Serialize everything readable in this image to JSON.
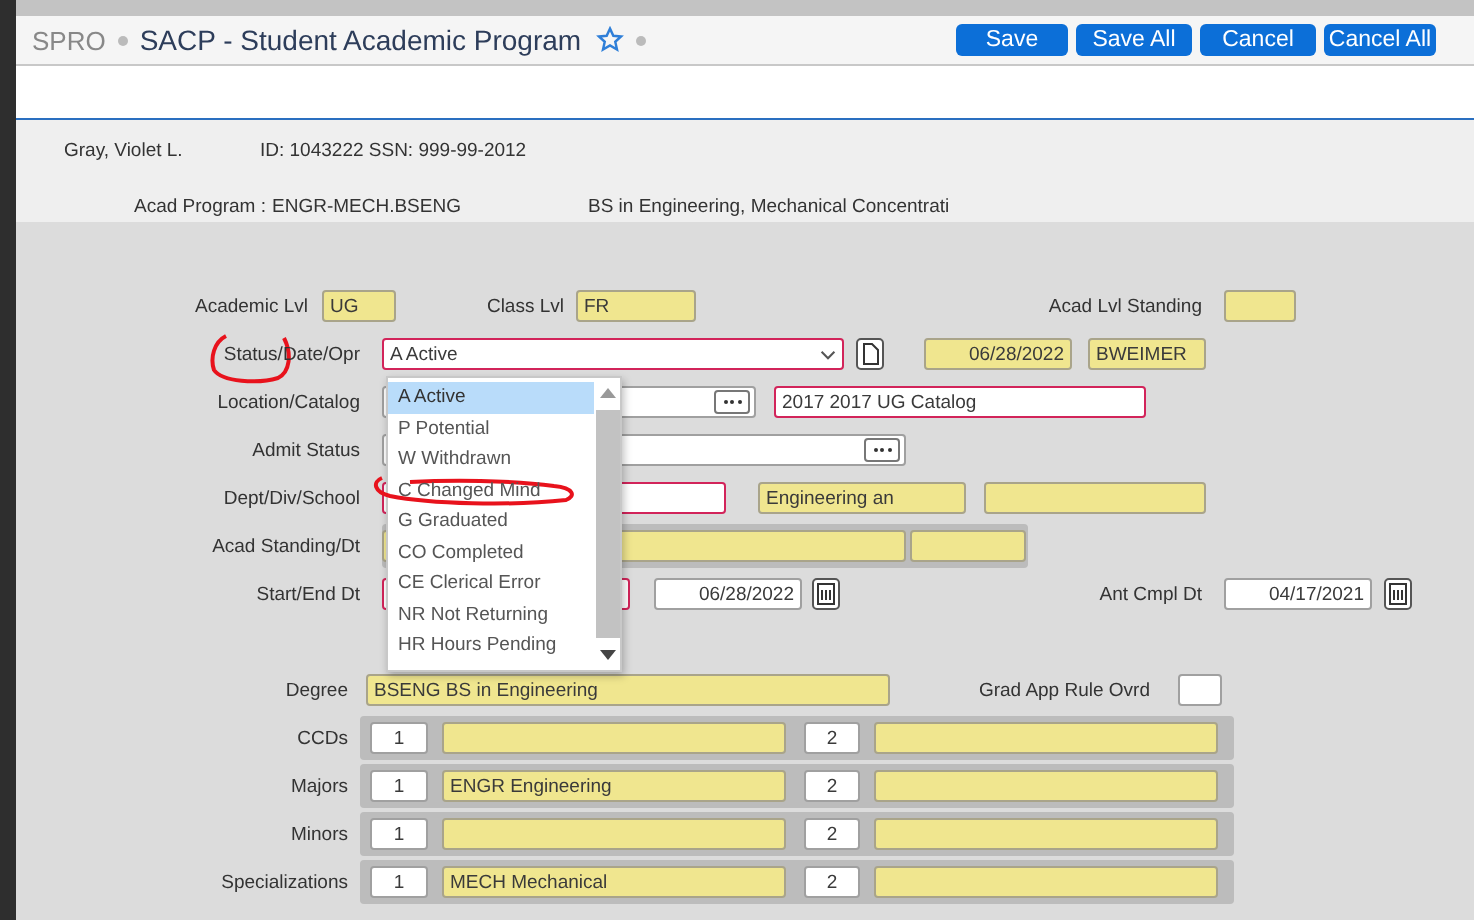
{
  "header": {
    "breadcrumb": "SPRO",
    "title": "SACP - Student Academic Program",
    "buttons": [
      "Save",
      "Save All",
      "Cancel",
      "Cancel All"
    ]
  },
  "student": {
    "name": "Gray,  Violet L.",
    "id_line": "ID: 1043222 SSN: 999-99-2012",
    "program_label": "Acad Program :",
    "program_code": "ENGR-MECH.BSENG",
    "program_desc": "BS in Engineering, Mechanical Concentrati"
  },
  "form": {
    "academic_lvl": {
      "label": "Academic Lvl",
      "value": "UG"
    },
    "class_lvl": {
      "label": "Class Lvl",
      "value": "FR"
    },
    "acad_lvl_standing": {
      "label": "Acad Lvl Standing"
    },
    "status": {
      "label": "Status/Date/Opr",
      "value": "A Active",
      "required": true,
      "date": "06/28/2022",
      "operator": "BWEIMER"
    },
    "location": {
      "label": "Location/Catalog",
      "required": false,
      "catalog": "2017 2017 UG Catalog",
      "catalog_required": true
    },
    "admit_status": {
      "label": "Admit Status",
      "required": false
    },
    "dept": {
      "label": "Dept/Div/School",
      "required": true,
      "division": "Engineering an"
    },
    "acad_standing": {
      "label": "Acad Standing/Dt"
    },
    "start_end": {
      "label": "Start/End Dt",
      "required": true,
      "end_date": "06/28/2022"
    },
    "ant_cmpl": {
      "label": "Ant Cmpl Dt",
      "value": "04/17/2021"
    },
    "degree": {
      "label": "Degree",
      "value": "BSENG BS in Engineering"
    },
    "grad_app": {
      "label": "Grad App Rule Ovrd"
    }
  },
  "multi": [
    {
      "label": "CCDs",
      "slot1": "1",
      "slot2": "2"
    },
    {
      "label": "Majors",
      "slot1": "1",
      "value1": "ENGR Engineering",
      "slot2": "2"
    },
    {
      "label": "Minors",
      "slot1": "1",
      "slot2": "2"
    },
    {
      "label": "Specializations",
      "slot1": "1",
      "value1": "MECH Mechanical",
      "slot2": "2"
    }
  ],
  "dropdown": [
    {
      "label": "A Active",
      "selected": true
    },
    {
      "label": "P Potential",
      "selected": false
    },
    {
      "label": "W Withdrawn",
      "selected": false
    },
    {
      "label": "C Changed Mind",
      "selected": false
    },
    {
      "label": "G Graduated",
      "selected": false
    },
    {
      "label": "CO Completed",
      "selected": false
    },
    {
      "label": "CE Clerical Error",
      "selected": false
    },
    {
      "label": "NR Not Returning",
      "selected": false
    },
    {
      "label": "HR Hours Pending",
      "selected": false
    }
  ]
}
